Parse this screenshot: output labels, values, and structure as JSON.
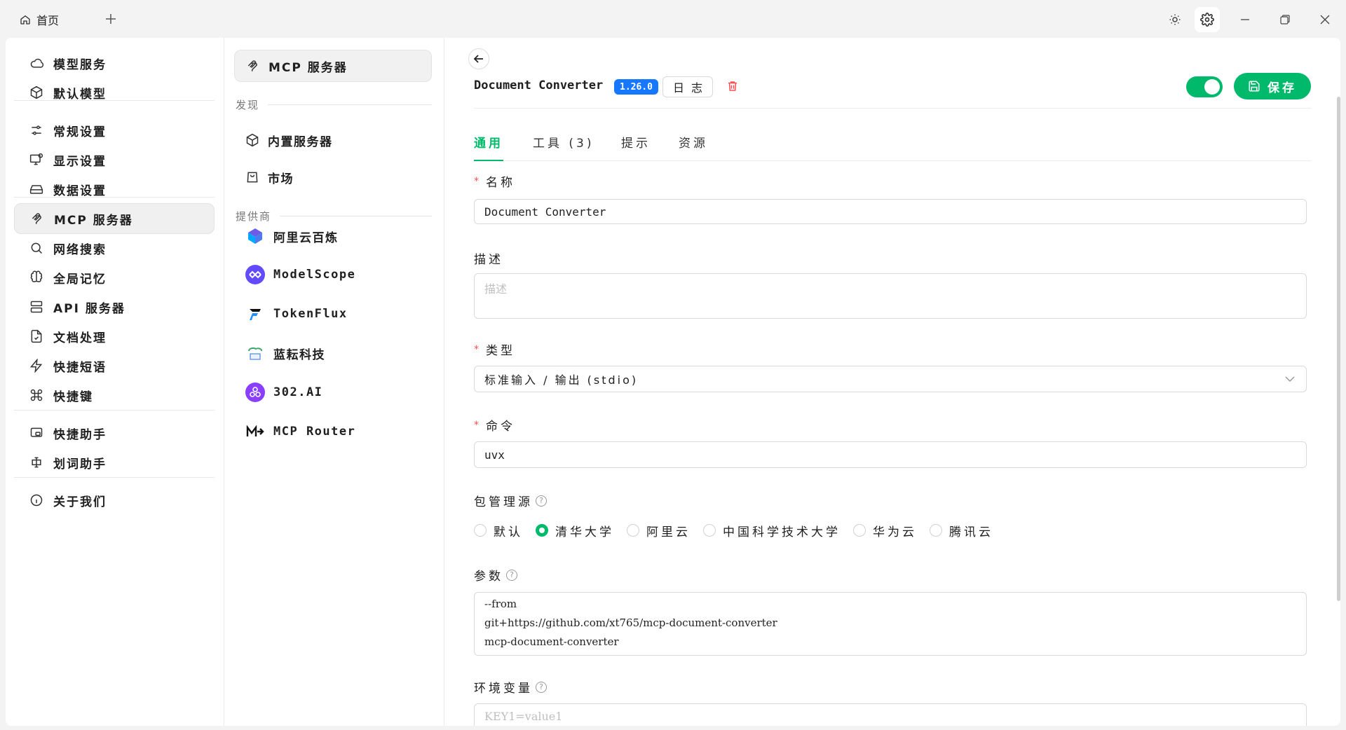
{
  "titlebar": {
    "home_tab_label": "首页",
    "add_tab_icon": "plus-icon",
    "controls": [
      "sun-icon",
      "gear-icon",
      "minimize-icon",
      "restore-icon",
      "close-icon"
    ]
  },
  "nav": {
    "items": [
      {
        "label": "模型服务",
        "icon": "cloud-icon"
      },
      {
        "label": "默认模型",
        "icon": "cube-icon"
      },
      {
        "label": "常规设置",
        "icon": "sliders-icon"
      },
      {
        "label": "显示设置",
        "icon": "monitor-icon"
      },
      {
        "label": "数据设置",
        "icon": "drive-icon"
      },
      {
        "label": "MCP 服务器",
        "icon": "mcp-icon"
      },
      {
        "label": "网络搜索",
        "icon": "search-icon"
      },
      {
        "label": "全局记忆",
        "icon": "brain-icon"
      },
      {
        "label": "API 服务器",
        "icon": "server-icon"
      },
      {
        "label": "文档处理",
        "icon": "document-icon"
      },
      {
        "label": "快捷短语",
        "icon": "zap-icon"
      },
      {
        "label": "快捷键",
        "icon": "command-icon"
      },
      {
        "label": "快捷助手",
        "icon": "window-icon"
      },
      {
        "label": "划词助手",
        "icon": "text-select-icon"
      },
      {
        "label": "关于我们",
        "icon": "info-icon"
      }
    ],
    "active": "MCP 服务器"
  },
  "list": {
    "header": "MCP 服务器",
    "discover_label": "发现",
    "discover_items": [
      {
        "label": "内置服务器",
        "icon": "cube-icon"
      },
      {
        "label": "市场",
        "icon": "shopping-bag-icon"
      }
    ],
    "providers_label": "提供商",
    "providers": [
      {
        "label": "阿里云百炼",
        "icon": "bailian-logo-icon"
      },
      {
        "label": "ModelScope",
        "icon": "modelscope-logo-icon"
      },
      {
        "label": "TokenFlux",
        "icon": "tokenflux-logo-icon"
      },
      {
        "label": "蓝耘科技",
        "icon": "lanyun-logo-icon"
      },
      {
        "label": "302.AI",
        "icon": "302ai-logo-icon"
      },
      {
        "label": "MCP Router",
        "icon": "mcp-router-logo-icon"
      }
    ]
  },
  "detail": {
    "name": "Document Converter",
    "version": "1.26.0",
    "log_label": "日志",
    "save_label": "保存",
    "enabled": true,
    "tabs": [
      "通用",
      "工具 (3)",
      "提示",
      "资源"
    ],
    "active_tab": "通用",
    "fields": {
      "name_label": "名称",
      "name_value": "Document Converter",
      "desc_label": "描述",
      "desc_placeholder": "描述",
      "type_label": "类型",
      "type_value": "标准输入 / 输出 (stdio)",
      "command_label": "命令",
      "command_value": "uvx",
      "registry_label": "包管理源",
      "registry_options": [
        "默认",
        "清华大学",
        "阿里云",
        "中国科学技术大学",
        "华为云",
        "腾讯云"
      ],
      "registry_selected": "清华大学",
      "args_label": "参数",
      "args_lines": [
        "--from",
        "git+https://github.com/xt765/mcp-document-converter",
        "mcp-document-converter"
      ],
      "env_label": "环境变量",
      "env_placeholder": "KEY1=value1"
    },
    "colors": {
      "accent": "#00b96b",
      "badge": "#1677ff",
      "danger": "#ff4d4f"
    }
  }
}
